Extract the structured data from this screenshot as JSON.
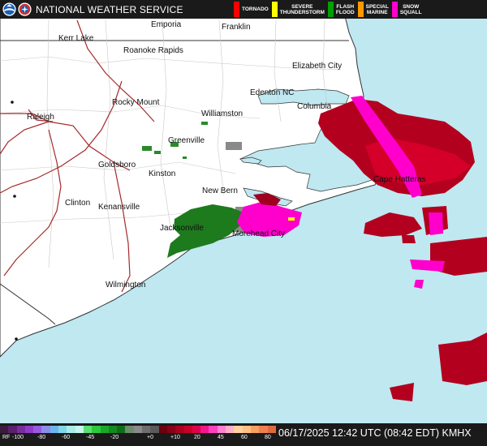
{
  "header": {
    "agency": "NATIONAL WEATHER SERVICE",
    "legend": [
      {
        "label": "TORNADO",
        "color": "#ff0000"
      },
      {
        "label": "SEVERE\nTHUNDERSTORM",
        "color": "#ffff00"
      },
      {
        "label": "FLASH\nFLOOD",
        "color": "#00a000"
      },
      {
        "label": "SPECIAL\nMARINE",
        "color": "#ff9900"
      },
      {
        "label": "SNOW\nSQUALL",
        "color": "#ff00cc"
      }
    ]
  },
  "cities": [
    "Emporia",
    "Franklin",
    "Kerr Lake",
    "Roanoke Rapids",
    "Elizabeth City",
    "Rocky Mount",
    "Edenton NC",
    "Columbia",
    "Raleigh",
    "Williamston",
    "Greenville",
    "Goldsboro",
    "Kinston",
    "Cape Hatteras",
    "New Bern",
    "Clinton",
    "Kenansville",
    "Jacksonville",
    "Morehead City",
    "Wilmington"
  ],
  "colorbar": {
    "prefix": "RF",
    "ticks": [
      "-100",
      "-80",
      "-60",
      "-45",
      "-20",
      "+0",
      "+10",
      "20",
      "45",
      "60",
      "80",
      "100"
    ]
  },
  "footer": {
    "timestamp": "06/17/2025 12:42 UTC (08:42 EDT)",
    "station": "KMHX"
  }
}
